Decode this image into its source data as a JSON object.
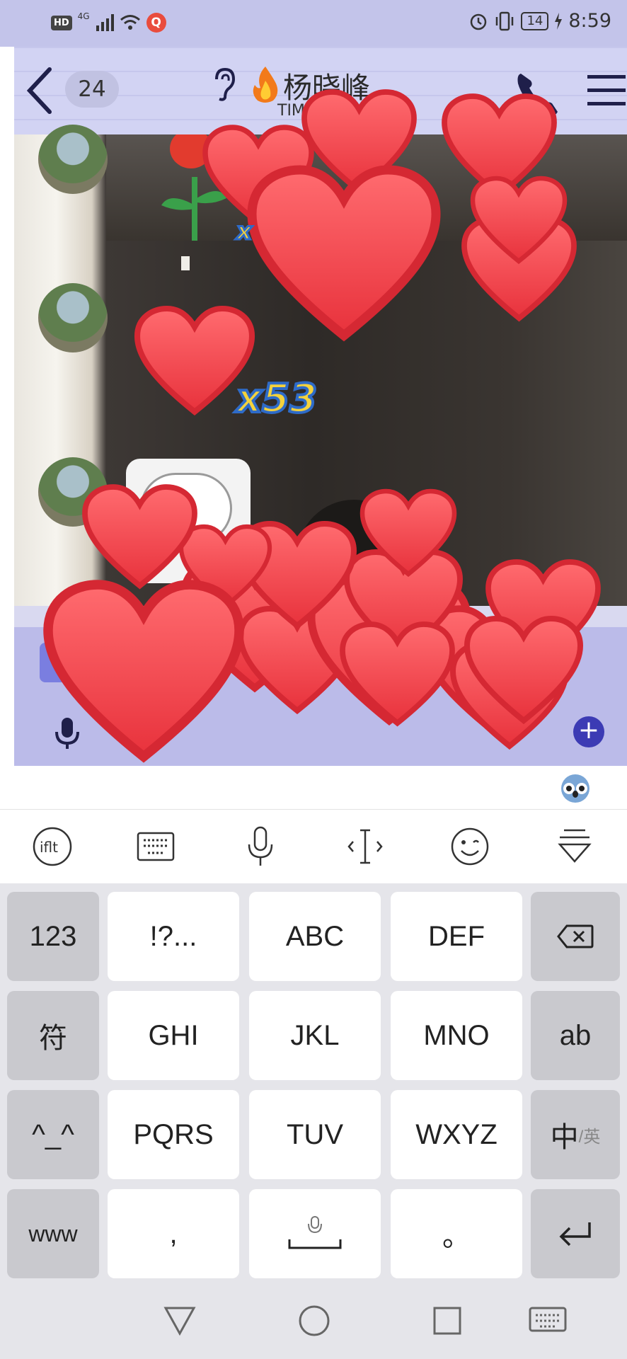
{
  "status_bar": {
    "hd": "HD",
    "network": "4G",
    "battery": "14",
    "time": "8:59"
  },
  "header": {
    "unread_count": "24",
    "title": "杨晓峰",
    "subtitle": "TIM"
  },
  "effects": {
    "combo_count": "x53",
    "combo_partial": "x"
  },
  "icons": {
    "back": "back-icon",
    "ear": "ear-icon",
    "fire": "fire-icon",
    "phone": "phone-icon",
    "menu": "menu-icon",
    "mic": "microphone-icon",
    "plus": "plus-icon",
    "koala": "koala-icon"
  },
  "keyboard": {
    "rows": [
      [
        "123",
        "!?...",
        "ABC",
        "DEF",
        "⌫"
      ],
      [
        "符",
        "GHI",
        "JKL",
        "MNO",
        "ab"
      ],
      [
        "^_^",
        "PQRS",
        "TUV",
        "WXYZ",
        "中"
      ],
      [
        "www",
        ",",
        "",
        "。",
        "↵"
      ]
    ],
    "zh_en_sub": "/英"
  },
  "colors": {
    "status_bg": "#c3c4ea",
    "chat_bg": "#b8b8ec",
    "heart": "#f0434b",
    "combo_text": "#f4d23c",
    "keyboard_bg": "#e5e5ea"
  }
}
